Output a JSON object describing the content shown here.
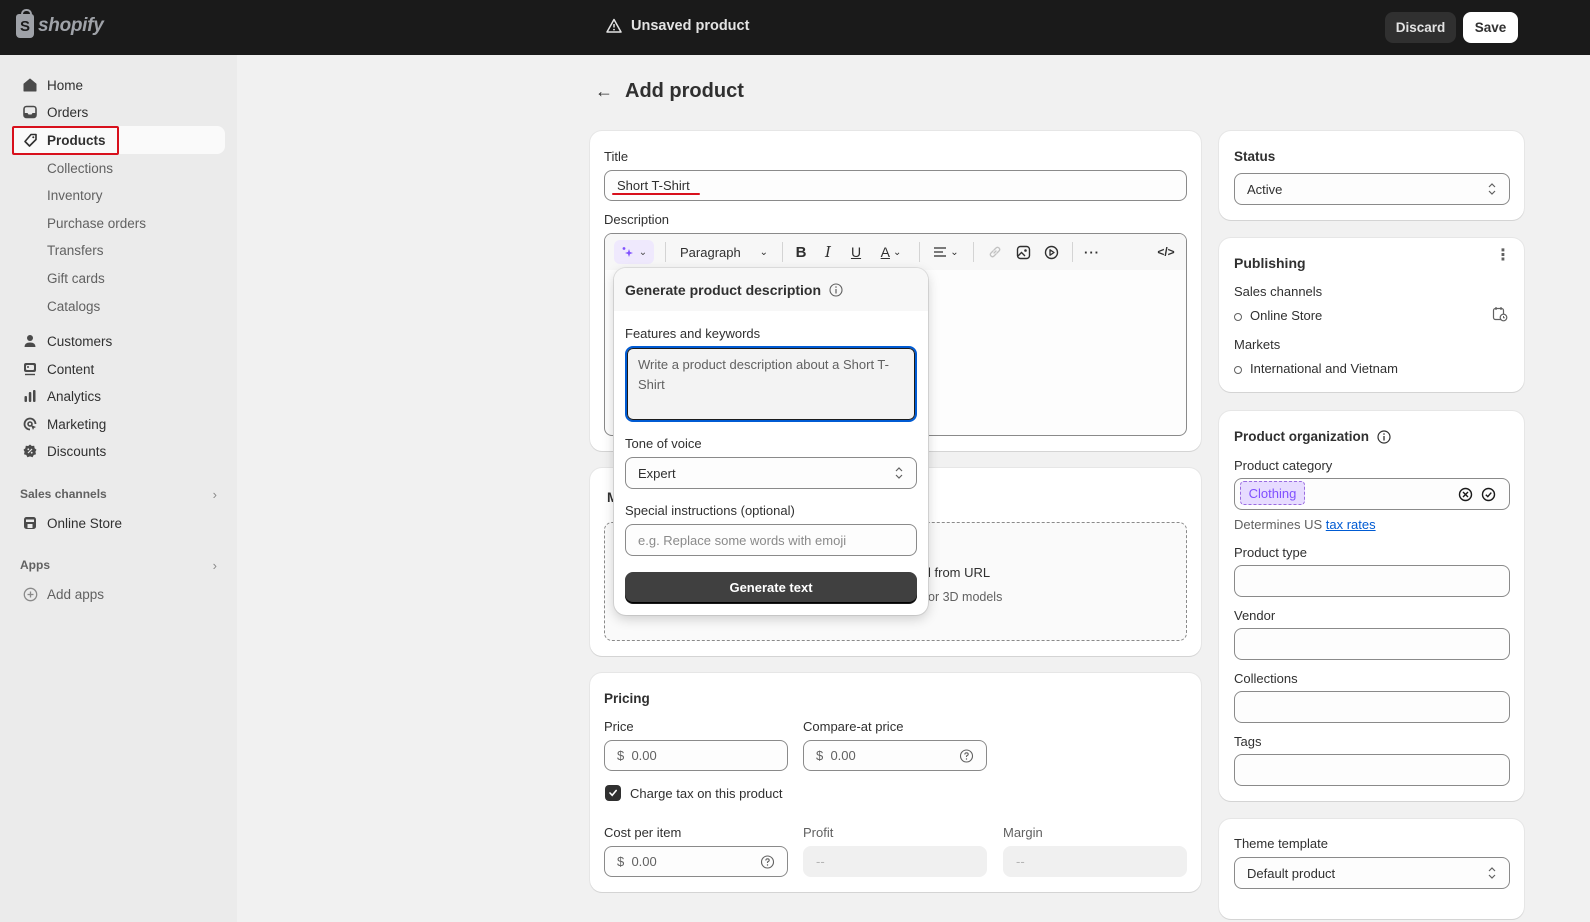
{
  "topbar": {
    "logo_text": "shopify",
    "logo_letter": "S",
    "status_text": "Unsaved product",
    "discard_label": "Discard",
    "save_label": "Save"
  },
  "sidebar": {
    "items": [
      {
        "label": "Home",
        "icon": "home-icon"
      },
      {
        "label": "Orders",
        "icon": "inbox-icon"
      },
      {
        "label": "Products",
        "icon": "tag-icon",
        "active": true
      },
      {
        "label": "Collections"
      },
      {
        "label": "Inventory"
      },
      {
        "label": "Purchase orders"
      },
      {
        "label": "Transfers"
      },
      {
        "label": "Gift cards"
      },
      {
        "label": "Catalogs"
      },
      {
        "label": "Customers",
        "icon": "person-icon"
      },
      {
        "label": "Content",
        "icon": "content-icon"
      },
      {
        "label": "Analytics",
        "icon": "bar-chart-icon"
      },
      {
        "label": "Marketing",
        "icon": "target-icon"
      },
      {
        "label": "Discounts",
        "icon": "discount-icon"
      }
    ],
    "sales_channels_label": "Sales channels",
    "online_store_label": "Online Store",
    "apps_label": "Apps",
    "add_apps_label": "Add apps"
  },
  "page": {
    "title": "Add product"
  },
  "product": {
    "title_label": "Title",
    "title_value": "Short T-Shirt",
    "description_label": "Description",
    "toolbar": {
      "paragraph_label": "Paragraph"
    },
    "media_label_partial": "M",
    "media_from_url_partial": "l from URL",
    "media_hint_partial": "or 3D models"
  },
  "generate_popover": {
    "title": "Generate product description",
    "features_label": "Features and keywords",
    "features_value": "Write a product description about a Short T-Shirt",
    "tone_label": "Tone of voice",
    "tone_value": "Expert",
    "special_label": "Special instructions (optional)",
    "special_placeholder": "e.g. Replace some words with emoji",
    "generate_label": "Generate text"
  },
  "pricing": {
    "title": "Pricing",
    "price_label": "Price",
    "price_value": "$  0.00",
    "compare_label": "Compare-at price",
    "compare_value": "$  0.00",
    "charge_tax_label": "Charge tax on this product",
    "charge_tax_checked": true,
    "cost_label": "Cost per item",
    "cost_value": "$  0.00",
    "profit_label": "Profit",
    "profit_value": "--",
    "margin_label": "Margin",
    "margin_value": "--"
  },
  "status": {
    "title": "Status",
    "value": "Active"
  },
  "publishing": {
    "title": "Publishing",
    "sales_channels_label": "Sales channels",
    "online_store": "Online Store",
    "markets_label": "Markets",
    "markets_value": "International and Vietnam"
  },
  "organization": {
    "title": "Product organization",
    "category_label": "Product category",
    "category_value": "Clothing",
    "tax_note_prefix": "Determines US ",
    "tax_link": "tax rates",
    "type_label": "Product type",
    "vendor_label": "Vendor",
    "collections_label": "Collections",
    "tags_label": "Tags"
  },
  "theme": {
    "title": "Theme template",
    "value": "Default product"
  },
  "colors": {
    "topbar": "#1a1a1a",
    "highlight": "#d8101c",
    "focus": "#005bd3",
    "ai_purple": "#8051ff"
  }
}
